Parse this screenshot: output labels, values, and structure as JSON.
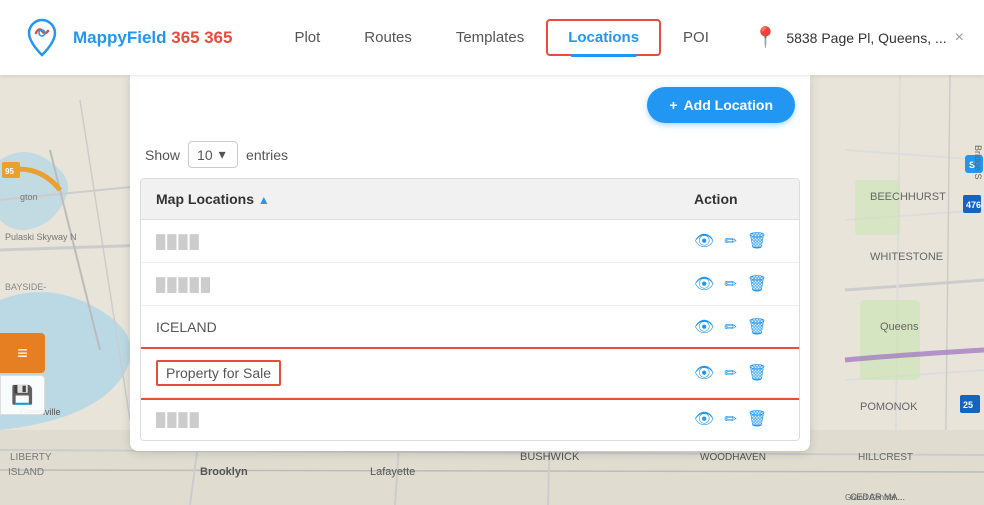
{
  "app": {
    "name": "MappyField",
    "name_suffix": "365"
  },
  "navbar": {
    "logo_alt": "MappyField 365 logo",
    "nav_items": [
      {
        "id": "plot",
        "label": "Plot",
        "active": false
      },
      {
        "id": "routes",
        "label": "Routes",
        "active": false
      },
      {
        "id": "templates",
        "label": "Templates",
        "active": false
      },
      {
        "id": "locations",
        "label": "Locations",
        "active": true
      },
      {
        "id": "poi",
        "label": "POI",
        "active": false
      }
    ],
    "location_address": "5838 Page Pl, Queens, ...",
    "close_label": "×"
  },
  "panel": {
    "add_button_label": "Add Location",
    "show_label": "Show",
    "entries_value": "10",
    "entries_label": "entries"
  },
  "table": {
    "col_locations": "Map Locations",
    "col_action": "Action",
    "rows": [
      {
        "id": 1,
        "name": "████",
        "blurred": true,
        "highlighted": false
      },
      {
        "id": 2,
        "name": "█████",
        "blurred": true,
        "highlighted": false
      },
      {
        "id": 3,
        "name": "ICELAND",
        "blurred": false,
        "highlighted": false
      },
      {
        "id": 4,
        "name": "Property for Sale",
        "blurred": false,
        "highlighted": true
      },
      {
        "id": 5,
        "name": "██████",
        "blurred": true,
        "highlighted": false
      }
    ]
  },
  "icons": {
    "eye": "👁",
    "edit": "✏",
    "delete": "🗑",
    "pin": "📍",
    "sort_up": "▲",
    "chevron_down": "▾",
    "menu": "≡",
    "save": "💾",
    "add": "+"
  },
  "colors": {
    "primary": "#2196F3",
    "accent": "#e74c3c",
    "orange": "#e67e22"
  }
}
